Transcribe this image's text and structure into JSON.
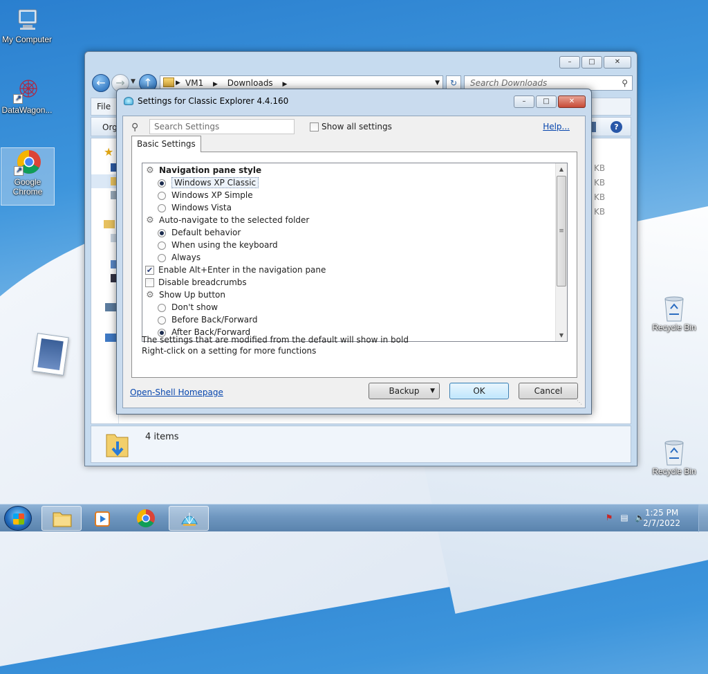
{
  "desktop": {
    "icons": [
      {
        "label": "My Computer"
      },
      {
        "label": "DataWagon..."
      },
      {
        "label": "Google Chrome"
      },
      {
        "label": "Recycle Bin"
      },
      {
        "label": "Recycle Bin"
      }
    ]
  },
  "explorer": {
    "address": {
      "segments": [
        "VM1",
        "Downloads"
      ]
    },
    "search_placeholder": "Search Downloads",
    "menu": {
      "file": "File"
    },
    "command": {
      "organize": "Org"
    },
    "size_unit": "KB",
    "status_count": "4 items",
    "caption": {
      "min": "–",
      "max": "□",
      "close": "✕"
    }
  },
  "dialog": {
    "title": "Settings for Classic Explorer 4.4.160",
    "search_placeholder": "Search Settings",
    "show_all_label": "Show all settings",
    "show_all_checked": false,
    "help_link": "Help...",
    "tab": "Basic Settings",
    "tree": [
      {
        "kind": "group",
        "label": "Navigation pane style",
        "bold": true
      },
      {
        "kind": "radio",
        "label": "Windows XP Classic",
        "checked": true,
        "focused": true
      },
      {
        "kind": "radio",
        "label": "Windows XP Simple",
        "checked": false
      },
      {
        "kind": "radio",
        "label": "Windows Vista",
        "checked": false
      },
      {
        "kind": "group",
        "label": "Auto-navigate to the selected folder"
      },
      {
        "kind": "radio",
        "label": "Default behavior",
        "checked": true
      },
      {
        "kind": "radio",
        "label": "When using the keyboard",
        "checked": false
      },
      {
        "kind": "radio",
        "label": "Always",
        "checked": false
      },
      {
        "kind": "check",
        "label": "Enable Alt+Enter in the navigation pane",
        "checked": true
      },
      {
        "kind": "check",
        "label": "Disable breadcrumbs",
        "checked": false
      },
      {
        "kind": "group",
        "label": "Show Up button"
      },
      {
        "kind": "radio",
        "label": "Don't show",
        "checked": false
      },
      {
        "kind": "radio",
        "label": "Before Back/Forward",
        "checked": false
      },
      {
        "kind": "radio",
        "label": "After Back/Forward",
        "checked": true
      }
    ],
    "hint_line1": "The settings that are modified from the default will show in bold",
    "hint_line2": "Right-click on a setting for more functions",
    "homepage_link": "Open-Shell Homepage",
    "buttons": {
      "backup": "Backup",
      "ok": "OK",
      "cancel": "Cancel"
    },
    "caption": {
      "min": "–",
      "max": "□",
      "close": "✕"
    }
  },
  "taskbar": {
    "time": "1:25 PM",
    "date": "2/7/2022"
  },
  "colors": {
    "accent": "#3c7fb1",
    "link": "#0645ad",
    "taskbar": "#6f97c0"
  }
}
